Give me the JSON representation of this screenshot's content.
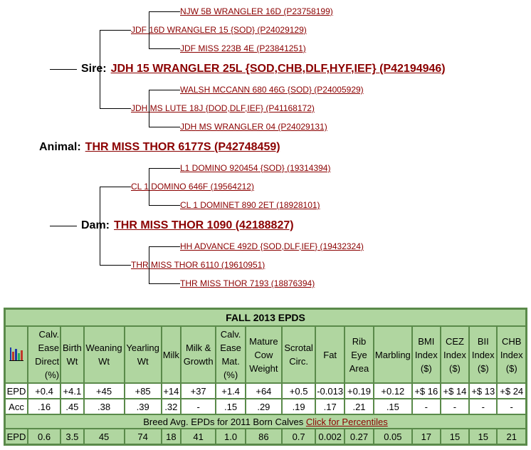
{
  "pedigree": {
    "sire_line": {
      "sire_sire_sire": "NJW 5B WRANGLER 16D (P23758199)",
      "sire_sire": "JDF 16D WRANGLER 15 {SOD} (P24029129)",
      "sire_sire_dam": "JDF MISS 223B 4E (P23841251)",
      "sire_label": "Sire:",
      "sire": "JDH 15 WRANGLER 25L {SOD,CHB,DLF,HYF,IEF} (P42194946)",
      "sire_dam_sire": "WALSH MCCANN 680 46G {SOD} (P24005929)",
      "sire_dam": "JDH MS LUTE 18J {DOD,DLF,IEF} (P41168172)",
      "sire_dam_dam": "JDH MS WRANGLER 04 (P24029131)"
    },
    "animal_label": "Animal:",
    "animal": "THR MISS THOR 6177S (P42748459)",
    "dam_line": {
      "dam_sire_sire": "L1 DOMINO 920454 {SOD} (19314394)",
      "dam_sire": "CL 1 DOMINO 646F (19564212)",
      "dam_sire_dam": "CL 1 DOMINET 890 2ET (18928101)",
      "dam_label": "Dam:",
      "dam": "THR MISS THOR 1090 (42188827)",
      "dam_dam_sire": "HH ADVANCE 492D {SOD,DLF,IEF} (19432324)",
      "dam_dam": "THR MISS THOR 6110 (19610951)",
      "dam_dam_dam": "THR MISS THOR 7193 (18876394)"
    }
  },
  "epd": {
    "title": "FALL 2013 EPDS",
    "icon": "bar-chart-icon",
    "headers": [
      "Calv. Ease Direct (%)",
      "Birth Wt",
      "Weaning Wt",
      "Yearling Wt",
      "Milk",
      "Milk & Growth",
      "Calv. Ease Mat. (%)",
      "Mature Cow Weight",
      "Scrotal Circ.",
      "Fat",
      "Rib Eye Area",
      "Marbling",
      "BMI Index ($)",
      "CEZ Index ($)",
      "BII Index ($)",
      "CHB Index ($)"
    ],
    "epd_label": "EPD",
    "epd_values": [
      "+0.4",
      "+4.1",
      "+45",
      "+85",
      "+14",
      "+37",
      "+1.4",
      "+64",
      "+0.5",
      "-0.013",
      "+0.19",
      "+0.12",
      "+$ 16",
      "+$ 14",
      "+$ 13",
      "+$ 24"
    ],
    "acc_label": "Acc",
    "acc_values": [
      ".16",
      ".45",
      ".38",
      ".39",
      ".32",
      "-",
      ".15",
      ".29",
      ".19",
      ".17",
      ".21",
      ".15",
      "-",
      "-",
      "-",
      "-"
    ],
    "breed_avg_text": "Breed Avg. EPDs for 2011 Born Calves",
    "percentiles_link": "Click for Percentiles",
    "avg_label": "EPD",
    "avg_values": [
      "0.6",
      "3.5",
      "45",
      "74",
      "18",
      "41",
      "1.0",
      "86",
      "0.7",
      "0.002",
      "0.27",
      "0.05",
      "17",
      "15",
      "15",
      "21"
    ]
  }
}
